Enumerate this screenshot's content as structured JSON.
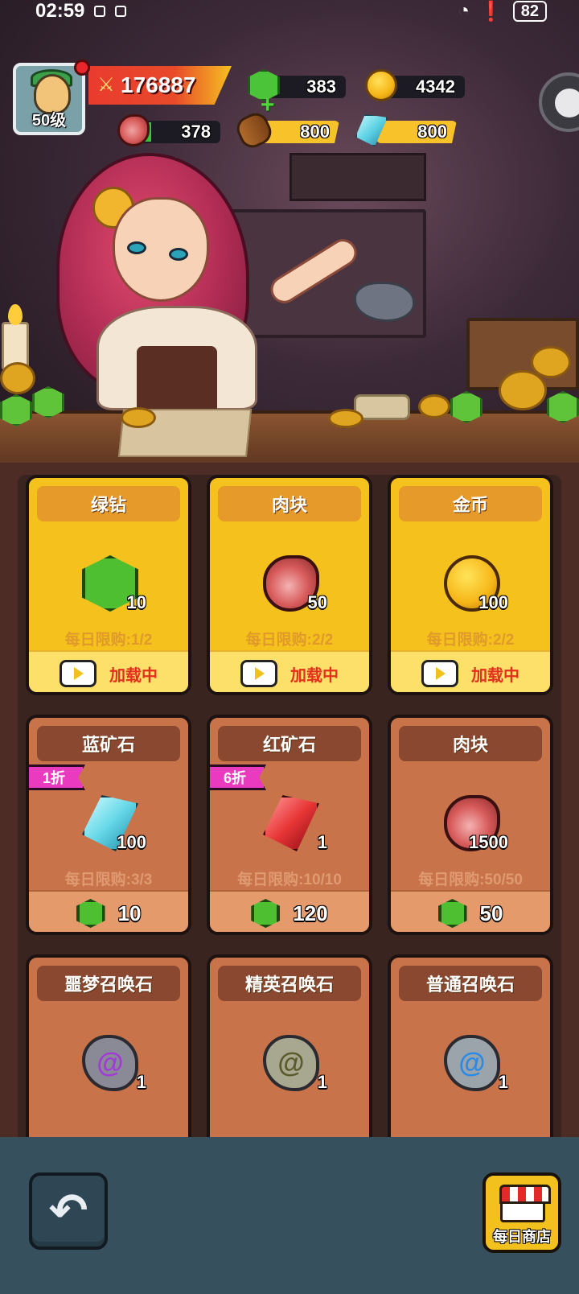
{
  "status_bar": {
    "time": "02:59",
    "battery": "82"
  },
  "hud": {
    "level": "50级",
    "power": "176887",
    "green_diamond": "383",
    "gold": "4342",
    "meat": "378",
    "wood": "800",
    "crystal": "800"
  },
  "shop": {
    "cards": [
      {
        "title": "绿钻",
        "qty": "10",
        "limit": "每日限购:1/2",
        "action": "加载中"
      },
      {
        "title": "肉块",
        "qty": "50",
        "limit": "每日限购:2/2",
        "action": "加载中"
      },
      {
        "title": "金币",
        "qty": "100",
        "limit": "每日限购:2/2",
        "action": "加载中"
      },
      {
        "title": "蓝矿石",
        "qty": "100",
        "limit": "每日限购:3/3",
        "price": "10",
        "badge": "1折"
      },
      {
        "title": "红矿石",
        "qty": "1",
        "limit": "每日限购:10/10",
        "price": "120",
        "badge": "6折"
      },
      {
        "title": "肉块",
        "qty": "1500",
        "limit": "每日限购:50/50",
        "price": "50"
      },
      {
        "title": "噩梦召唤石",
        "qty": "1"
      },
      {
        "title": "精英召唤石",
        "qty": "1"
      },
      {
        "title": "普通召唤石",
        "qty": "1"
      }
    ]
  },
  "footer": {
    "back_icon": "back-arrow-icon",
    "daily_shop_label": "每日商店"
  },
  "colors": {
    "card_yellow": "#f5c21d",
    "card_brown": "#c8734a",
    "bottom_bar": "#36505e",
    "badge_pink": "#e93ac0",
    "loading_red": "#e2301d"
  }
}
